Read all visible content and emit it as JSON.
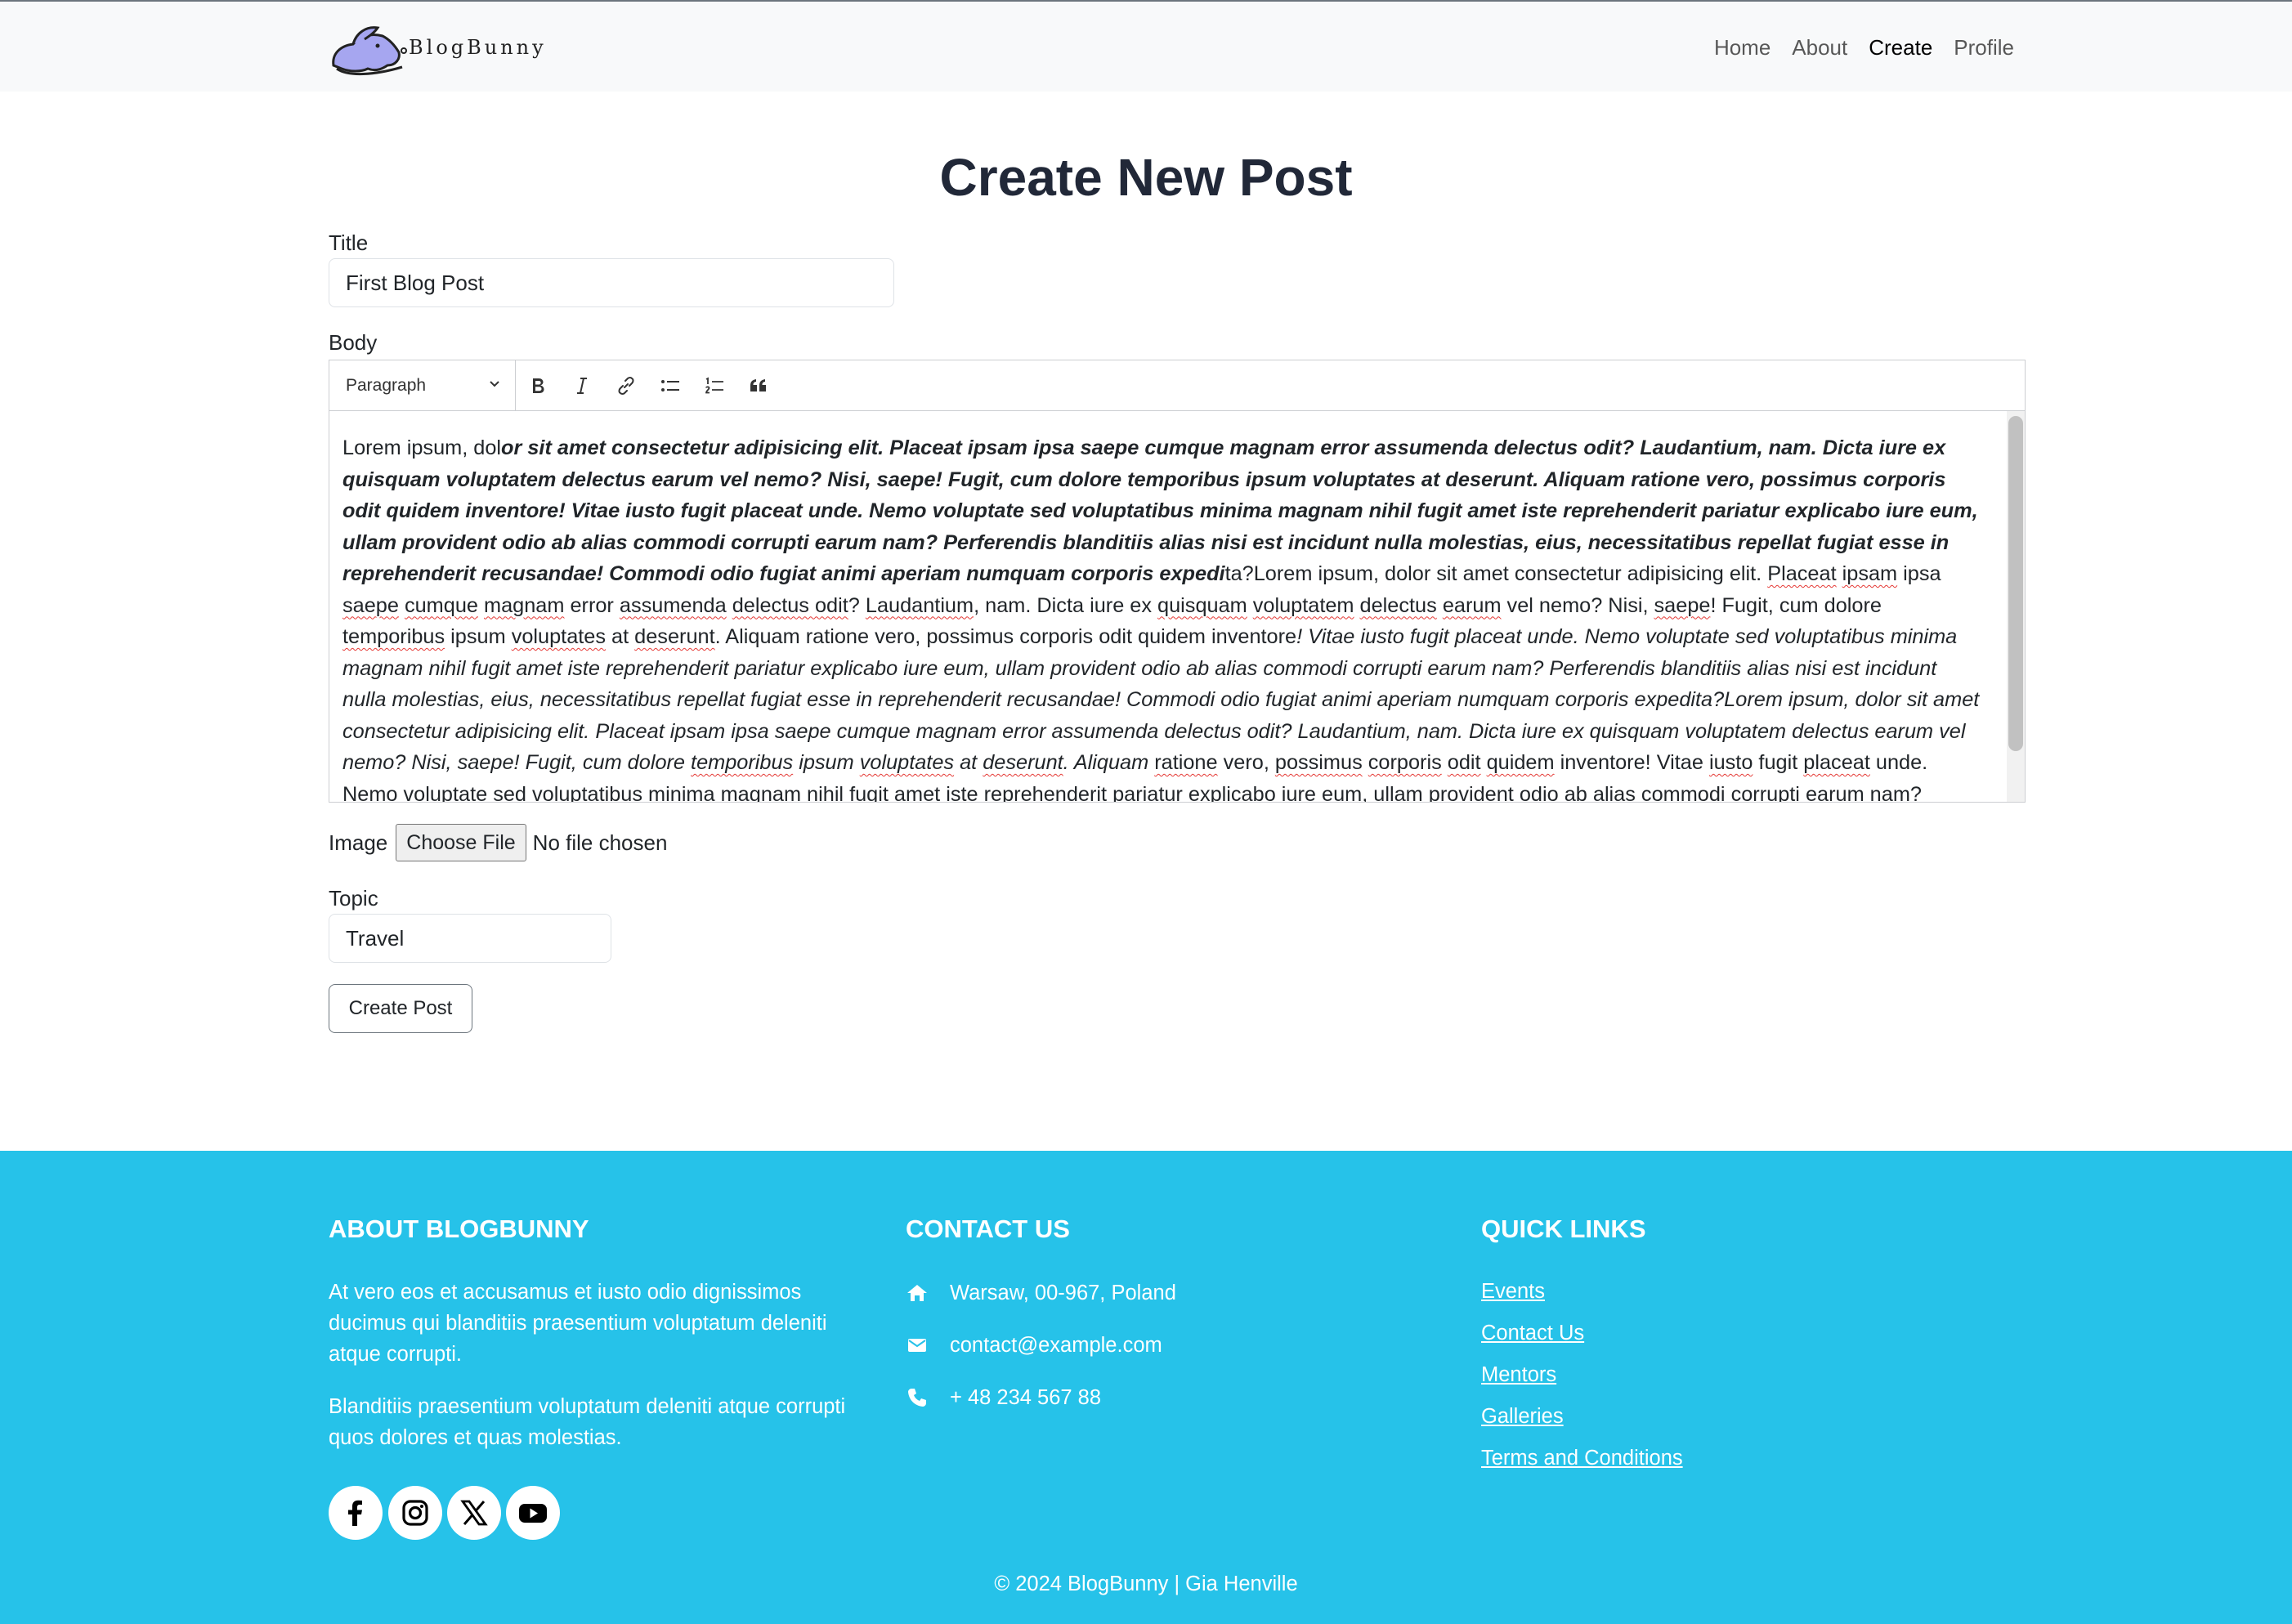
{
  "navbar": {
    "brand": "BlogBunny",
    "links": [
      "Home",
      "About",
      "Create",
      "Profile"
    ],
    "active": "Create"
  },
  "main": {
    "page_title": "Create New Post",
    "title_label": "Title",
    "title_value": "First Blog Post",
    "body_label": "Body",
    "toolbar": {
      "heading_select": "Paragraph",
      "buttons": [
        "bold-icon",
        "italic-icon",
        "link-icon",
        "bulleted-list-icon",
        "numbered-list-icon",
        "blockquote-icon"
      ]
    },
    "body_segments": [
      {
        "text": "Lorem ipsum, dol",
        "style": "plain"
      },
      {
        "text": "or sit amet consectetur adipisicing elit. Placeat ipsam ipsa saepe cumque magnam error assumenda delectus odit? Laudantium, nam. Dicta iure ex quisquam voluptatem delectus earum vel nemo? Nisi, saepe! Fugit, cum dolore temporibus ipsum voluptates at deserunt. Aliquam ratione vero, possimus corporis odit quidem inventore! Vitae iusto fugit placeat unde. Nemo voluptate sed voluptatibus minima magnam nihil fugit amet iste reprehenderit pariatur explicabo iure eum, ullam provident odio ab alias commodi corrupti earum nam? Perferendis blanditiis alias nisi est incidunt nulla molestias, eius, necessitatibus repellat fugiat esse in reprehenderit recusandae! Commodi odio fugiat animi aperiam numquam corporis expedi",
        "style": "bold-italic"
      },
      {
        "text": "ta?Lorem ipsum, dolor sit amet consectetur adipisicing elit. ",
        "style": "plain"
      },
      {
        "text": "Placeat",
        "style": "spell"
      },
      {
        "text": " ",
        "style": "plain"
      },
      {
        "text": "ipsam",
        "style": "spell"
      },
      {
        "text": " ipsa ",
        "style": "plain"
      },
      {
        "text": "saepe",
        "style": "spell"
      },
      {
        "text": " ",
        "style": "plain"
      },
      {
        "text": "cumque",
        "style": "spell"
      },
      {
        "text": " ",
        "style": "plain"
      },
      {
        "text": "magnam",
        "style": "spell"
      },
      {
        "text": " error ",
        "style": "plain"
      },
      {
        "text": "assumenda",
        "style": "spell"
      },
      {
        "text": " ",
        "style": "plain"
      },
      {
        "text": "delectus odit",
        "style": "spell"
      },
      {
        "text": "? ",
        "style": "plain"
      },
      {
        "text": "Laudantium",
        "style": "spell"
      },
      {
        "text": ", nam. Dicta iure ex ",
        "style": "plain"
      },
      {
        "text": "quisquam",
        "style": "spell"
      },
      {
        "text": " ",
        "style": "plain"
      },
      {
        "text": "voluptatem",
        "style": "spell"
      },
      {
        "text": " ",
        "style": "plain"
      },
      {
        "text": "delectus",
        "style": "spell"
      },
      {
        "text": " ",
        "style": "plain"
      },
      {
        "text": "earum",
        "style": "spell"
      },
      {
        "text": " vel nemo? Nisi, ",
        "style": "plain"
      },
      {
        "text": "saepe",
        "style": "spell"
      },
      {
        "text": "! Fugit, cum dolore ",
        "style": "plain"
      },
      {
        "text": "temporibus",
        "style": "spell"
      },
      {
        "text": " ipsum ",
        "style": "plain"
      },
      {
        "text": "voluptates",
        "style": "spell"
      },
      {
        "text": " at ",
        "style": "plain"
      },
      {
        "text": "deserunt",
        "style": "spell"
      },
      {
        "text": ". Aliquam ratione vero, possimus corporis odit quidem inventore",
        "style": "plain"
      },
      {
        "text": "! Vitae iusto fugit placeat unde. Nemo voluptate sed voluptatibus minima magnam nihil fugit amet iste reprehenderit pariatur explicabo iure eum, ullam provident odio ab alias commodi corrupti earum nam? Perferendis blanditiis alias nisi est incidunt nulla molestias, eius, necessitatibus repellat fugiat esse in reprehenderit recusandae! Commodi odio fugiat animi aperiam numquam corporis expedita?Lorem ipsum, dolor sit amet consectetur adipisicing elit. Placeat ipsam ipsa saepe cumque magnam error assumenda delectus odit? Laudantium, nam. Dicta iure ex quisquam voluptatem delectus earum vel nemo? Nisi, saepe! Fugit, cum dolore ",
        "style": "italic"
      },
      {
        "text": "temporibus",
        "style": "italic-spell"
      },
      {
        "text": " ipsum ",
        "style": "italic"
      },
      {
        "text": "voluptates",
        "style": "italic-spell"
      },
      {
        "text": " at ",
        "style": "italic"
      },
      {
        "text": "deserunt",
        "style": "italic-spell"
      },
      {
        "text": ". Aliquam ",
        "style": "italic"
      },
      {
        "text": "ratione",
        "style": "spell"
      },
      {
        "text": " vero, ",
        "style": "plain"
      },
      {
        "text": "possimus",
        "style": "spell"
      },
      {
        "text": " ",
        "style": "plain"
      },
      {
        "text": "corporis",
        "style": "spell"
      },
      {
        "text": " ",
        "style": "plain"
      },
      {
        "text": "odit",
        "style": "spell"
      },
      {
        "text": " ",
        "style": "plain"
      },
      {
        "text": "quidem",
        "style": "spell"
      },
      {
        "text": " inventore! Vitae ",
        "style": "plain"
      },
      {
        "text": "iusto",
        "style": "spell"
      },
      {
        "text": " fugit ",
        "style": "plain"
      },
      {
        "text": "placeat",
        "style": "spell"
      },
      {
        "text": " unde. Nemo voluptate sed voluptatibus minima magnam nihil fugit amet iste reprehenderit pariatur explicabo iure eum, ullam provident odio ab alias commodi corrupti earum nam? Perferendis blanditiis alias nisi est incidunt nulla molestias, eius, necessitatibus repellat fugiat esse in reprehenderit recusandae! Commodi odio fugiat animi aperiam numquam corporis expedita?",
        "style": "plain"
      }
    ],
    "image_label": "Image",
    "file_button": "Choose File",
    "file_status": "No file chosen",
    "topic_label": "Topic",
    "topic_value": "Travel",
    "submit_label": "Create Post"
  },
  "footer": {
    "about_heading": "ABOUT BLOGBUNNY",
    "about_text_1": "At vero eos et accusamus et iusto odio dignissimos ducimus qui blanditiis praesentium voluptatum deleniti atque corrupti.",
    "about_text_2": "Blanditiis praesentium voluptatum deleniti atque corrupti quos dolores et quas molestias.",
    "social": [
      "facebook-icon",
      "instagram-icon",
      "x-icon",
      "youtube-icon"
    ],
    "contact_heading": "CONTACT US",
    "address": "Warsaw, 00-967, Poland",
    "email": "contact@example.com",
    "phone": "+ 48 234 567 88",
    "links_heading": "QUICK LINKS",
    "links": [
      "Events",
      "Contact Us",
      "Mentors",
      "Galleries",
      "Terms and Conditions"
    ],
    "copyright": "© 2024 BlogBunny | Gia Henville"
  },
  "colors": {
    "footer_bg": "#26c2e9",
    "navbar_bg": "#f8f9fa",
    "title_color": "#212838",
    "bunny": "#a6a6f0"
  }
}
